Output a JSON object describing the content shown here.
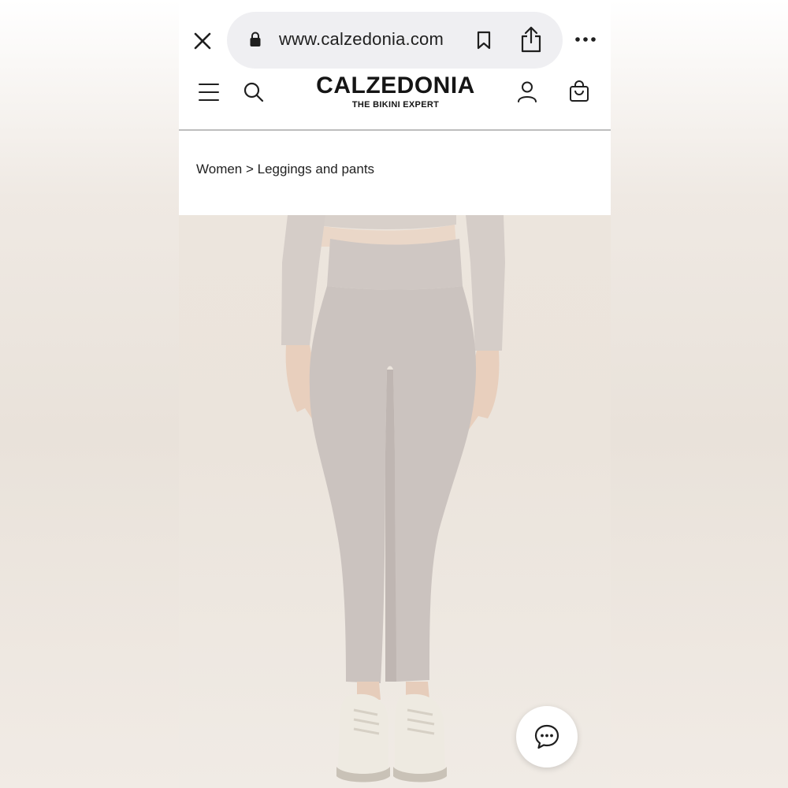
{
  "browser": {
    "url": "www.calzedonia.com",
    "icons": [
      "close-icon",
      "lock-icon",
      "bookmark-icon",
      "share-icon",
      "more-icon"
    ]
  },
  "header": {
    "logo_main": "CALZEDONIA",
    "logo_sub": "THE BIKINI EXPERT",
    "icons": [
      "menu-icon",
      "search-icon",
      "account-icon",
      "bag-icon"
    ]
  },
  "breadcrumb": {
    "text": "Women > Leggings and pants"
  },
  "product": {
    "image_alt": "",
    "chat_icon": "chat-icon"
  },
  "colors": {
    "accent": "#151515",
    "pill_bg": "#efeff2",
    "image_bg": "#ebe4dc",
    "legging": "#cbc3bf"
  }
}
